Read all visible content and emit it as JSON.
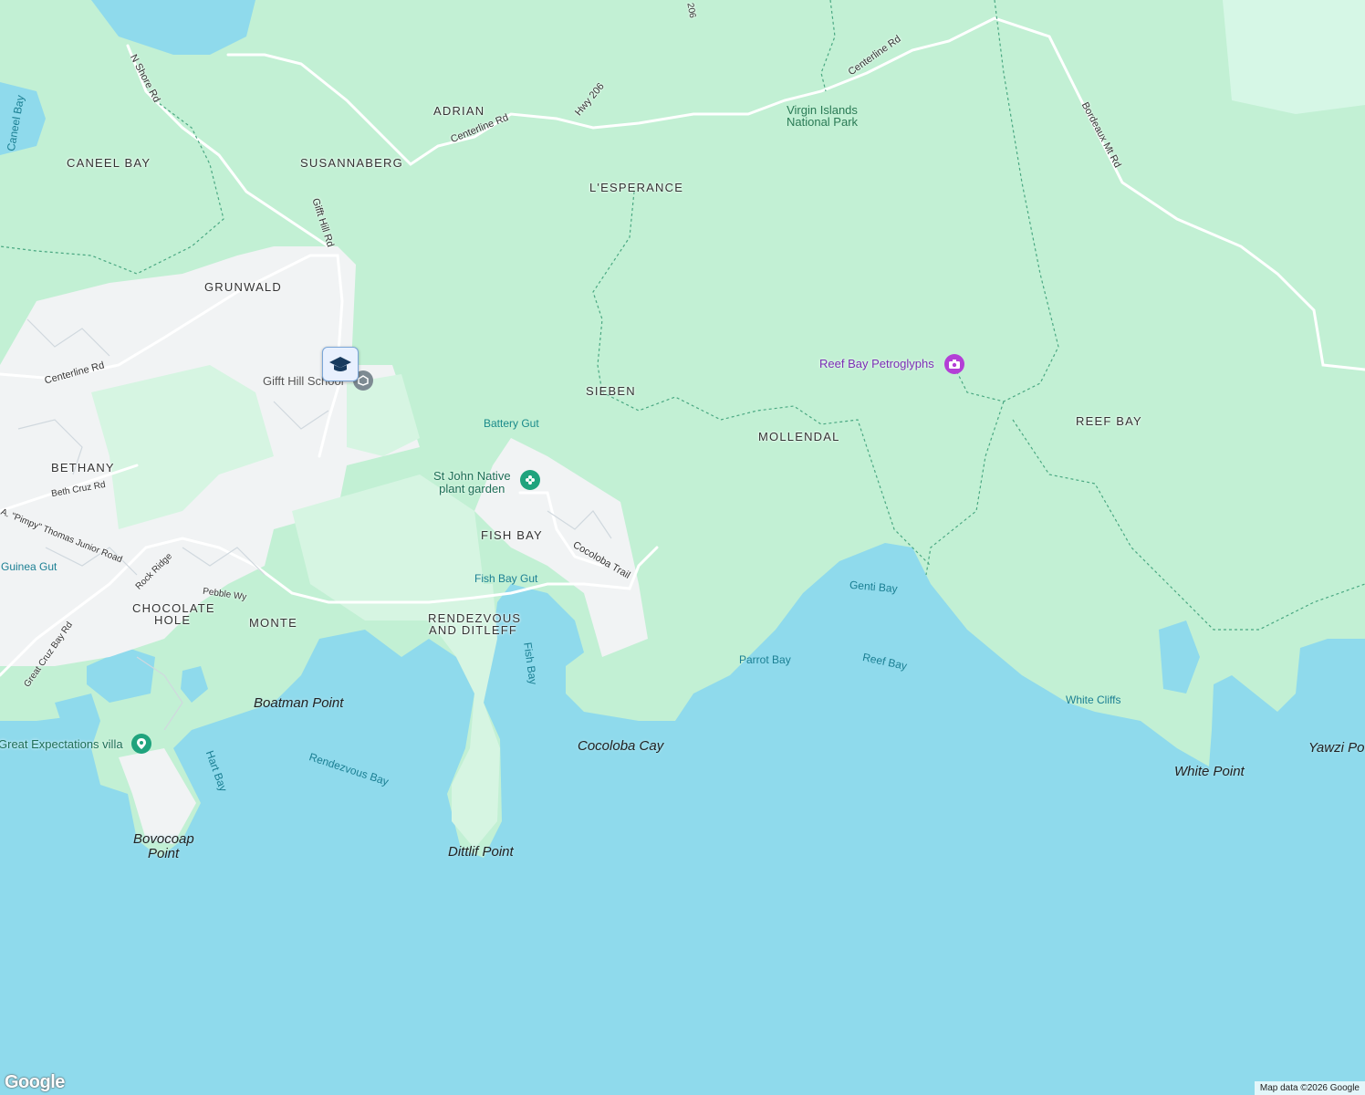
{
  "map": {
    "areas": [
      "ADRIAN",
      "SUSANNABERG",
      "CANEEL BAY",
      "L'ESPERANCE",
      "GRUNWALD",
      "SIEBEN",
      "MOLLENDAL",
      "REEF BAY",
      "BETHANY",
      "FISH BAY",
      "CHOCOLATE",
      "HOLE",
      "MONTE",
      "RENDEZVOUS",
      "AND DITLEFF"
    ],
    "roads": [
      "N Shore Rd",
      "Centerline Rd",
      "Hwy 206",
      "Centerline Rd",
      "Bordeaux Mt Rd",
      "Gifft Hill Rd",
      "Centerline Rd",
      "Beth Cruz Rd",
      "A. \"Pimpy\" Thomas Junior Road",
      "Rock Ridge",
      "Pebble Wy",
      "Great Cruz Bay Rd",
      "Cocoloba Trail",
      "206"
    ],
    "water": [
      "Caneel Bay",
      "Guinea Gut",
      "Fish Bay Gut",
      "Fish Bay",
      "Genti Bay",
      "Parrot Bay",
      "Reef Bay",
      "White Cliffs",
      "Rendezvous Bay",
      "Hart Bay",
      "Battery Gut"
    ],
    "points": [
      "Boatman Point",
      "Cocoloba Cay",
      "White Point",
      "Yawzi Po",
      "Bovocoap",
      "Point",
      "Dittlif Point"
    ],
    "park": [
      "Virgin Islands",
      "National Park"
    ],
    "pois": {
      "petroglyphs": "Reef Bay Petroglyphs",
      "garden_line1": "St John Native",
      "garden_line2": "plant garden",
      "school": "Gifft Hill School",
      "villa": "Great Expectations villa"
    }
  },
  "footer": {
    "attribution": "Map data ©2026 Google",
    "logo": "Google"
  },
  "colors": {
    "ocean": "#8fdaec",
    "park": "#c2f0d4",
    "urban": "#f1f3f4",
    "greenArea": "#d6f5e2"
  }
}
